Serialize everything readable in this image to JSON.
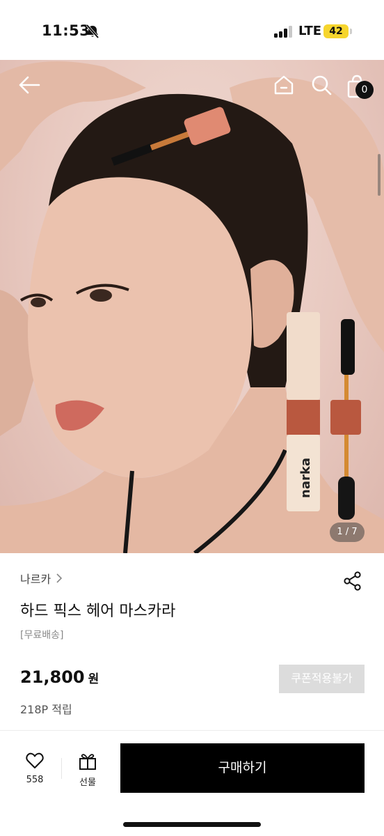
{
  "status_bar": {
    "time": "11:53",
    "network": "LTE",
    "battery": "42"
  },
  "header": {
    "icons": [
      "back-arrow-icon",
      "home-icon",
      "search-icon",
      "shopping-bag-icon"
    ],
    "cart_count": "0"
  },
  "gallery": {
    "pager": "1 / 7",
    "product_print": "narka"
  },
  "product": {
    "brand": "나르카",
    "title": "하드 픽스 헤어 마스카라",
    "shipping": "[무료배송]",
    "price": "21,800",
    "currency": "원",
    "coupon_label": "쿠폰적용불가",
    "points": "218P 적립"
  },
  "bottom_bar": {
    "like_count": "558",
    "gift_label": "선물",
    "buy_label": "구매하기"
  },
  "colors": {
    "accent": "#000000",
    "coupon_disabled": "#dcdcdc",
    "battery": "#f6d52e"
  }
}
